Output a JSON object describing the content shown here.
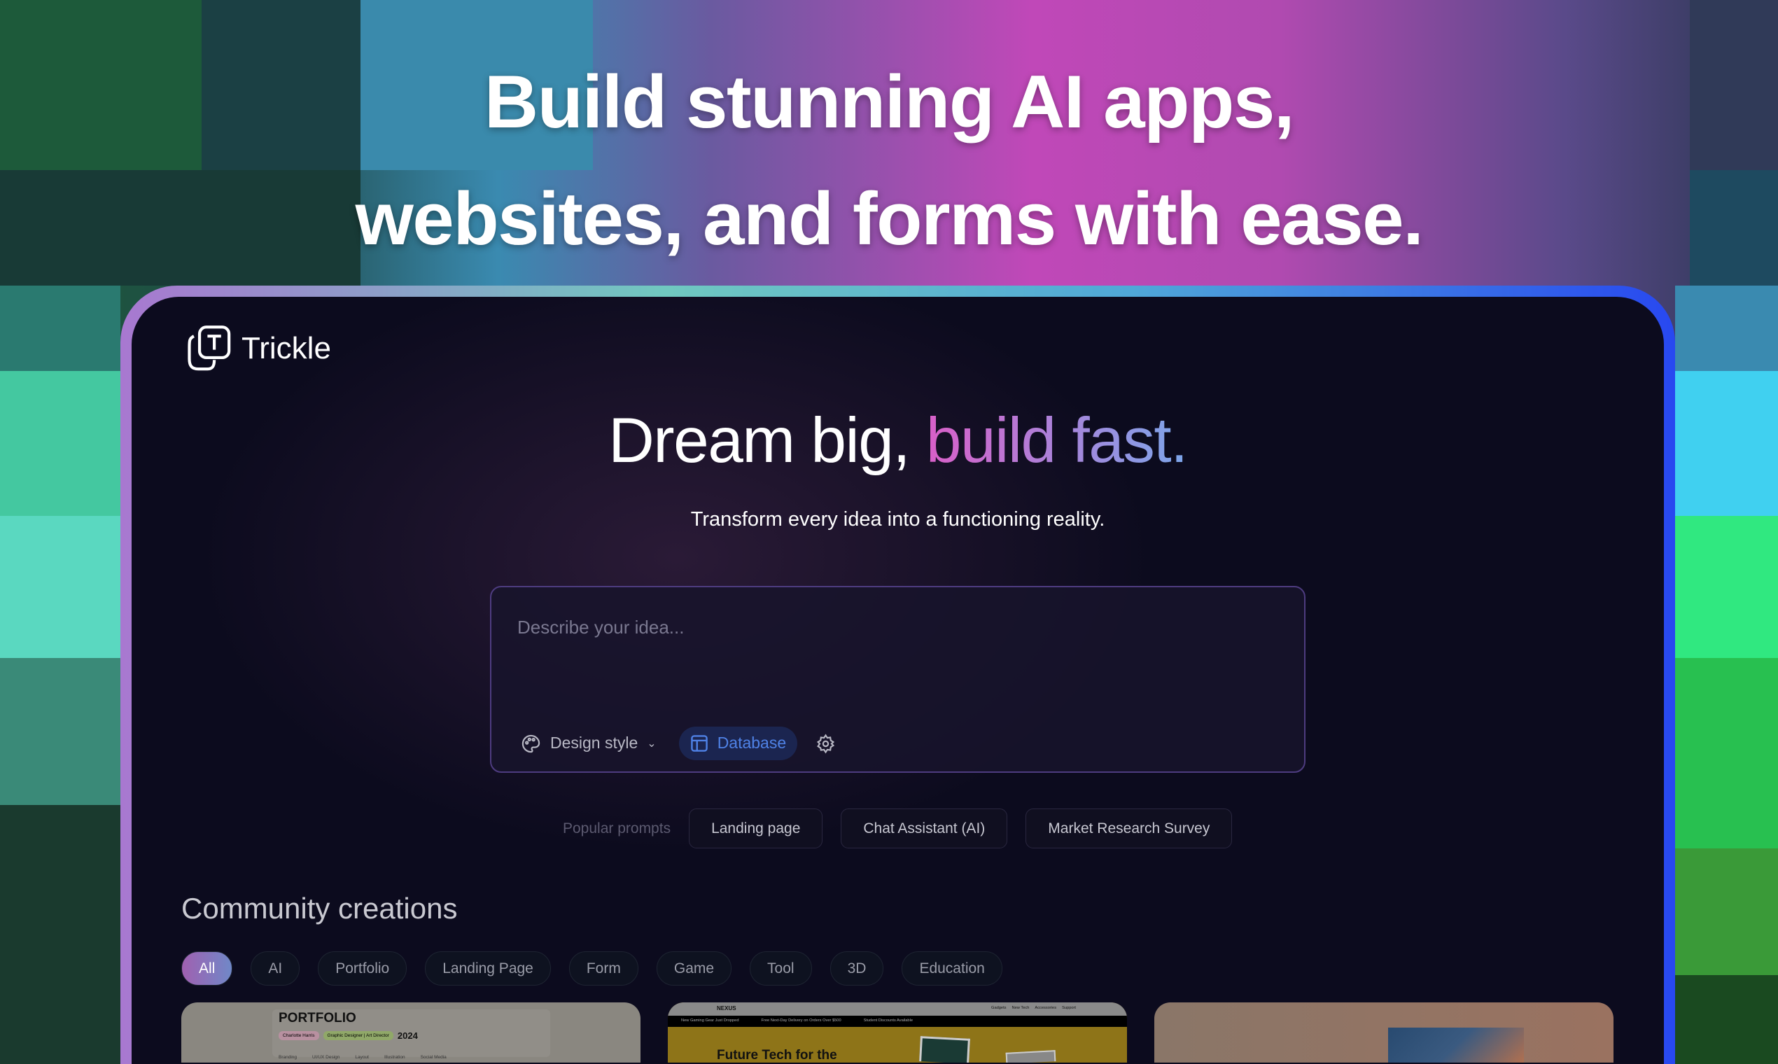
{
  "banner": {
    "line1": "Build stunning AI apps,",
    "line2": "websites, and forms with ease."
  },
  "app": {
    "name": "Trickle",
    "logo_icon": "trickle-logo-icon"
  },
  "hero": {
    "title_plain": "Dream big, ",
    "title_accent": "build fast.",
    "subtitle": "Transform every idea into a functioning reality."
  },
  "prompt_box": {
    "placeholder": "Describe your idea...",
    "design_style": "Design style",
    "database": "Database"
  },
  "popular": {
    "label": "Popular prompts",
    "items": [
      "Landing page",
      "Chat Assistant (AI)",
      "Market Research Survey"
    ]
  },
  "community": {
    "title": "Community creations",
    "filters": [
      "All",
      "AI",
      "Portfolio",
      "Landing Page",
      "Form",
      "Game",
      "Tool",
      "3D",
      "Education"
    ],
    "active_filter": "All"
  },
  "cards": [
    {
      "title": "PORTFOLIO",
      "tags": [
        "Charlotte Harris",
        "Graphic Designer | Art Director"
      ],
      "year": "2024",
      "nav": [
        "Branding",
        "UI/UX Design",
        "Layout",
        "Illustration",
        "Social Media"
      ]
    },
    {
      "brand": "NEXUS",
      "nav": [
        "Gadgets",
        "New Tech",
        "Accessories",
        "Support"
      ],
      "ticker": [
        "New Gaming Gear Just Dropped",
        "Free Next-Day Delivery on Orders Over $500",
        "Student Discounts Available"
      ],
      "headline": "Future Tech for the"
    },
    {}
  ],
  "colors": {
    "accent_blue": "#4f82e6",
    "panel_bg": "#0c0b1e",
    "gradient_pink": "#d95fc8",
    "gradient_blue": "#7ca6ea"
  }
}
